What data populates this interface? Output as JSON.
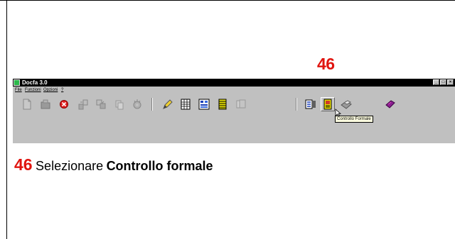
{
  "callout_number": "46",
  "window": {
    "title": "Docfa 3.0",
    "controls": [
      "_",
      "□",
      "×"
    ]
  },
  "menu": [
    "File",
    "Funzioni",
    "Opzioni",
    "?"
  ],
  "toolbar": {
    "icons": [
      "new-document-icon",
      "open-folder-icon",
      "delete-icon",
      "export-icon",
      "import-icon",
      "copy-icon",
      "gear-icon",
      "pencil-icon",
      "grid-icon",
      "form-icon",
      "list-icon",
      "pages-icon",
      "columns-icon",
      "formal-check-icon",
      "printer-icon",
      "book-icon"
    ],
    "active_tooltip": "Controllo Formale"
  },
  "instruction": {
    "number": "46",
    "prefix": "Selezionare",
    "action": "Controllo formale"
  },
  "colors": {
    "accent_red": "#e0140f",
    "titlebar": "#000000",
    "window_face": "#c0c0c0",
    "tooltip_bg": "#ffffe1"
  }
}
